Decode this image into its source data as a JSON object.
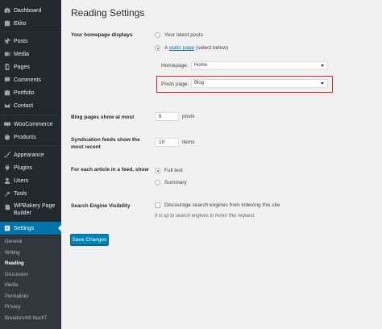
{
  "sidebar": {
    "items": [
      {
        "label": "Dashboard",
        "icon": "dashboard-icon"
      },
      {
        "label": "Ekko",
        "icon": "ekko-icon"
      },
      {
        "label": "Posts",
        "icon": "pin-icon"
      },
      {
        "label": "Media",
        "icon": "media-icon"
      },
      {
        "label": "Pages",
        "icon": "page-icon"
      },
      {
        "label": "Comments",
        "icon": "comment-icon"
      },
      {
        "label": "Portfolio",
        "icon": "portfolio-icon"
      },
      {
        "label": "Contact",
        "icon": "mail-icon"
      },
      {
        "label": "WooCommerce",
        "icon": "woocommerce-icon"
      },
      {
        "label": "Products",
        "icon": "products-icon"
      },
      {
        "label": "Appearance",
        "icon": "brush-icon"
      },
      {
        "label": "Plugins",
        "icon": "plugin-icon"
      },
      {
        "label": "Users",
        "icon": "user-icon"
      },
      {
        "label": "Tools",
        "icon": "wrench-icon"
      },
      {
        "label": "WPBakery Page Builder",
        "icon": "wpbakery-icon"
      },
      {
        "label": "Settings",
        "icon": "settings-icon"
      }
    ],
    "submenu": [
      "General",
      "Writing",
      "Reading",
      "Discussion",
      "Media",
      "Permalinks",
      "Privacy",
      "Breadcrumb NavXT"
    ]
  },
  "page": {
    "title": "Reading Settings",
    "homepage_displays": {
      "label": "Your homepage displays",
      "option_latest": "Your latest posts",
      "option_static_prefix": "A",
      "option_static_link": "static page",
      "option_static_suffix": "(select below)",
      "homepage_label": "Homepage:",
      "homepage_value": "Home",
      "posts_page_label": "Posts page:",
      "posts_page_value": "Blog"
    },
    "blog_pages": {
      "label": "Blog pages show at most",
      "value": "6",
      "unit": "posts"
    },
    "syndication": {
      "label_line1": "Syndication feeds show the",
      "label_line2": "most recent",
      "value": "10",
      "unit": "items"
    },
    "feed_article": {
      "label": "For each article in a feed, show",
      "option_full": "Full text",
      "option_summary": "Summary"
    },
    "visibility": {
      "label": "Search Engine Visibility",
      "checkbox_label": "Discourage search engines from indexing this site",
      "description": "It is up to search engines to honor this request."
    },
    "save_button": "Save Changes"
  },
  "colors": {
    "sidebar_bg": "#23282d",
    "active": "#0073aa",
    "highlight": "#d9232d",
    "button": "#0085ba"
  }
}
